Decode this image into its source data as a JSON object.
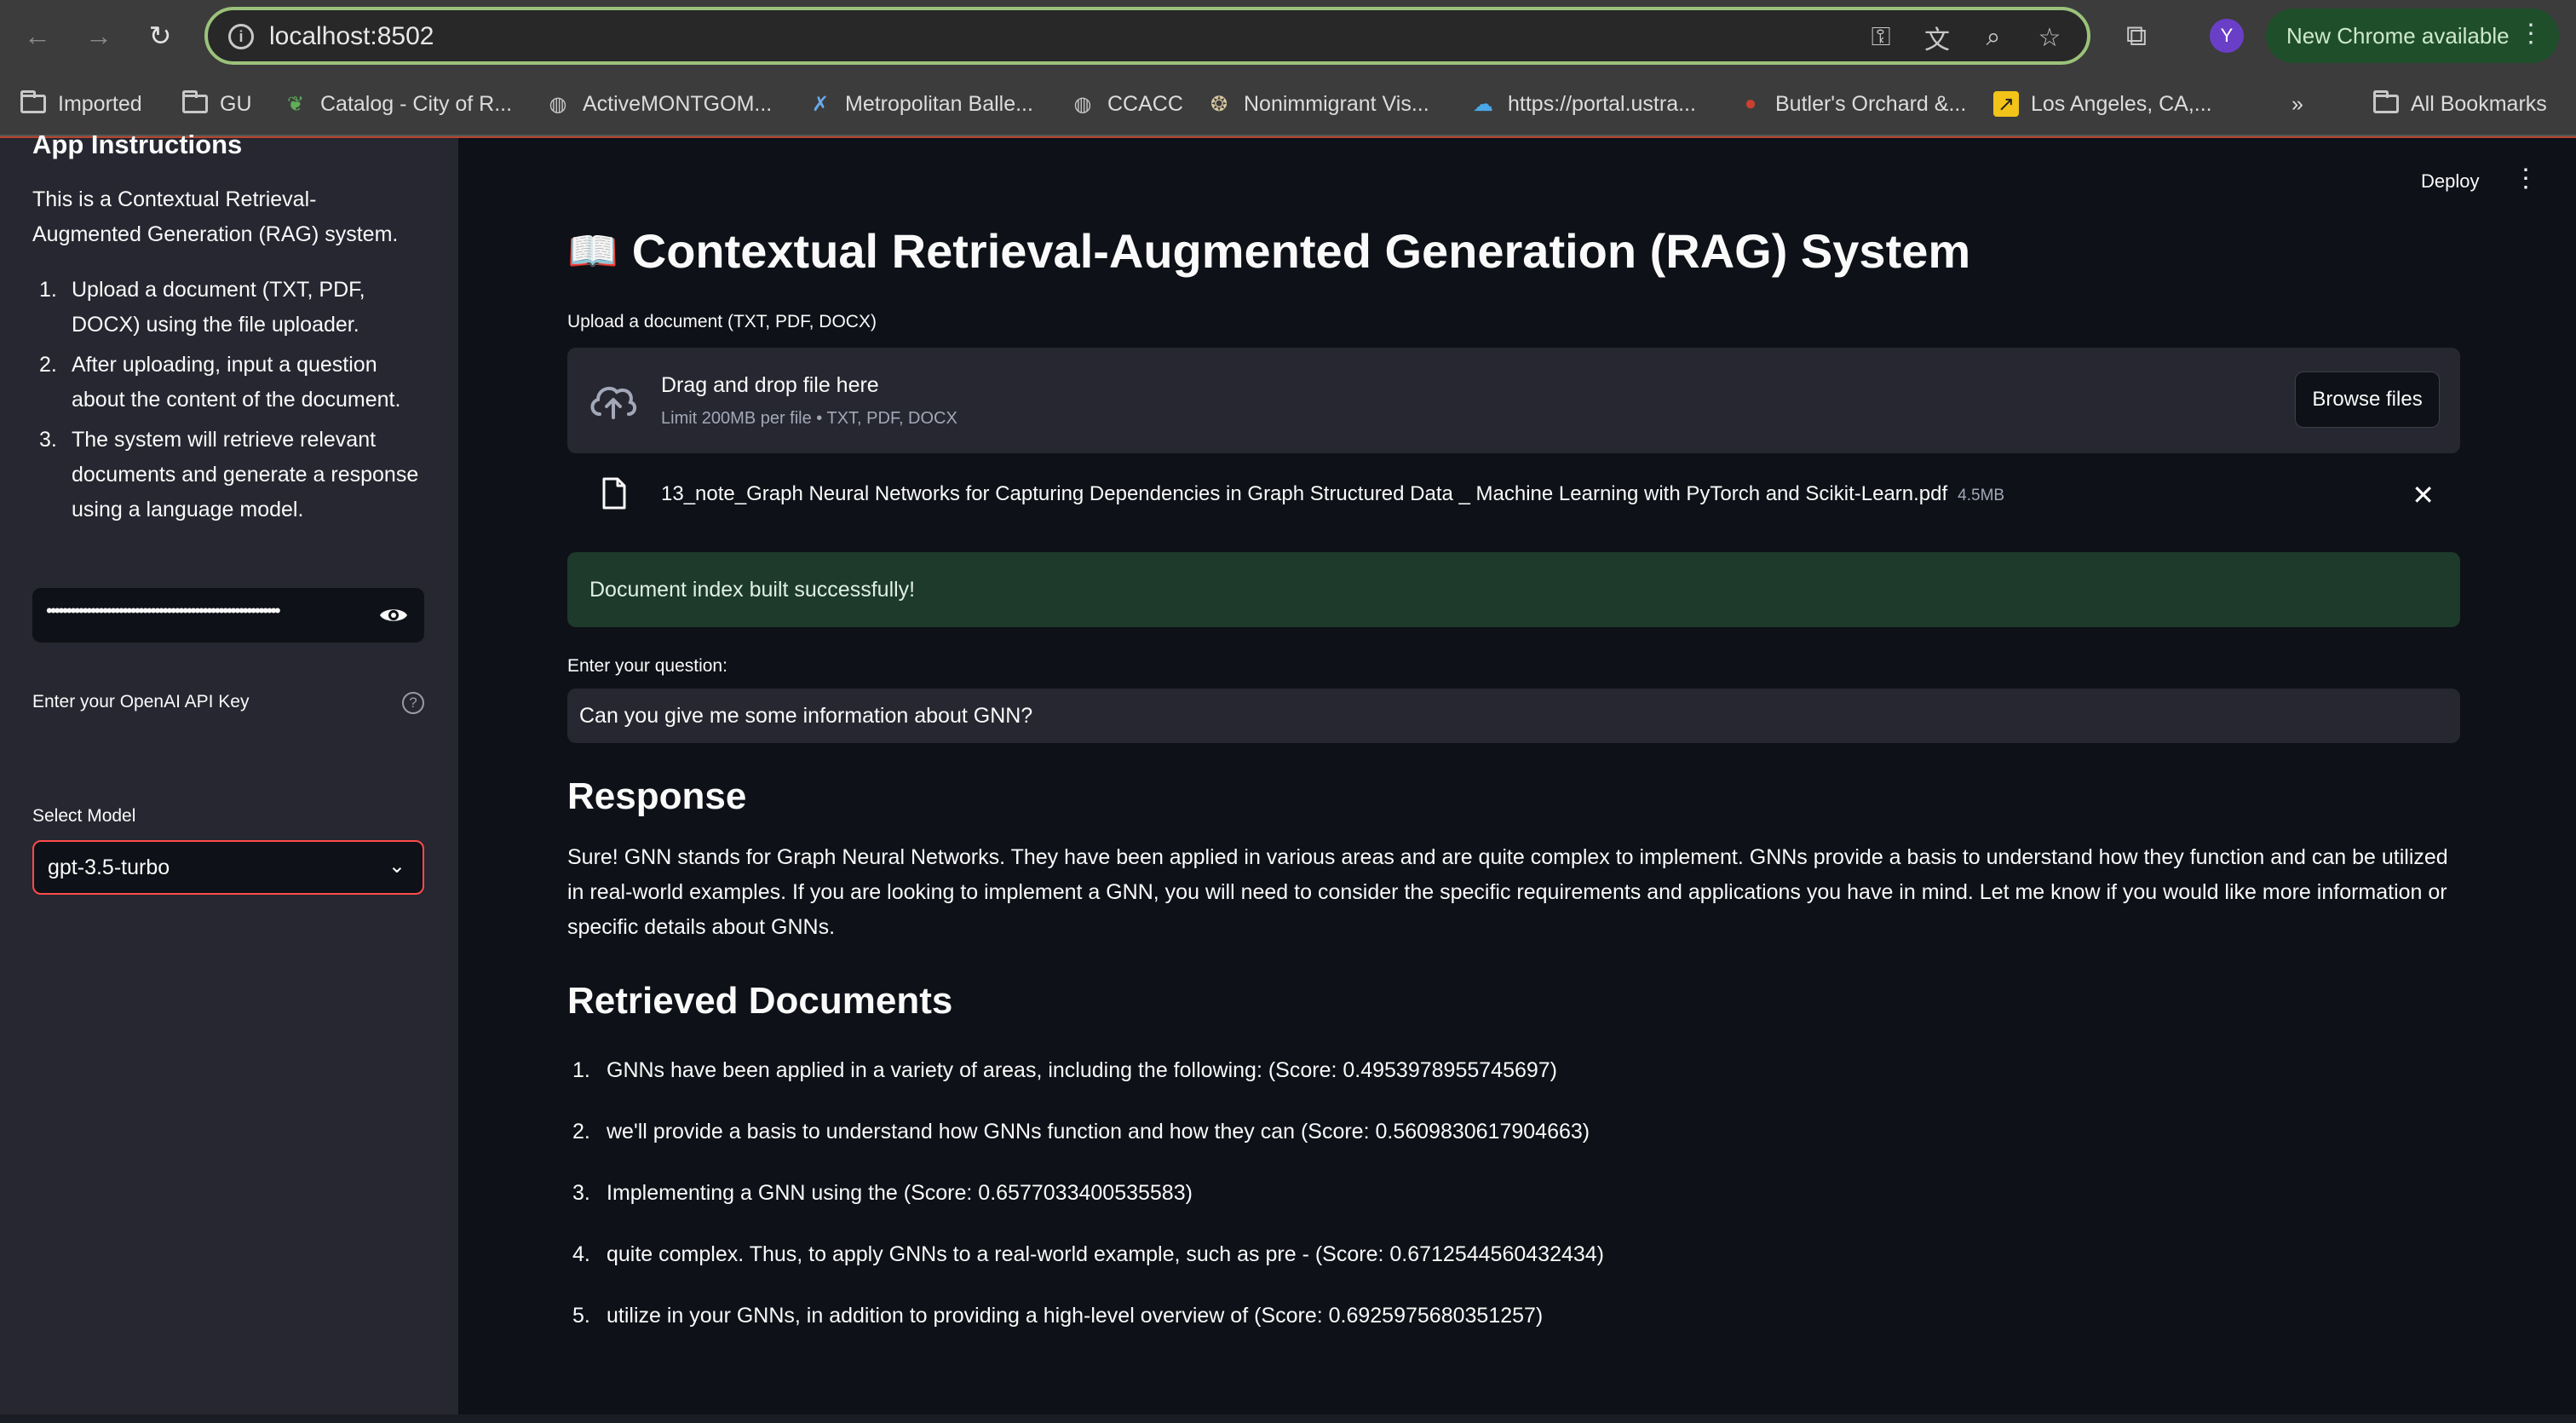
{
  "browser": {
    "url": "localhost:8502",
    "profile_initial": "Y",
    "update_label": "New Chrome available",
    "bookmarks": [
      "Imported",
      "GU",
      "Catalog - City of R...",
      "ActiveMONTGOM...",
      "Metropolitan Balle...",
      "CCACC",
      "Nonimmigrant Vis...",
      "https://portal.ustra...",
      "Butler's Orchard &...",
      "Los Angeles, CA,...",
      "All Bookmarks"
    ],
    "overflow_label": "»"
  },
  "sidebar": {
    "title": "App Instructions",
    "description": "This is a Contextual Retrieval-Augmented Generation (RAG) system.",
    "steps": [
      "Upload a document (TXT, PDF, DOCX) using the file uploader.",
      "After uploading, input a question about the content of the document.",
      "The system will retrieve relevant documents and generate a response using a language model."
    ],
    "api_key_label": "Enter your OpenAI API Key",
    "api_key_value": "••••••••••••••••••••••••••••••••••••••••••••••••••••••••••",
    "model_label": "Select Model",
    "model_value": "gpt-3.5-turbo"
  },
  "header": {
    "deploy_label": "Deploy"
  },
  "main": {
    "title_icon": "📖",
    "title": "Contextual Retrieval-Augmented Generation (RAG) System",
    "upload_label": "Upload a document (TXT, PDF, DOCX)",
    "dropzone_main": "Drag and drop file here",
    "dropzone_sub": "Limit 200MB per file • TXT, PDF, DOCX",
    "browse_label": "Browse files",
    "file_name": "13_note_Graph Neural Networks for Capturing Dependencies in Graph Structured Data _ Machine Learning with PyTorch and Scikit-Learn.pdf",
    "file_size": "4.5MB",
    "success_message": "Document index built successfully!",
    "question_label": "Enter your question:",
    "question_value": "Can you give me some information about GNN?",
    "response_heading": "Response",
    "response_text": "Sure! GNN stands for Graph Neural Networks. They have been applied in various areas and are quite complex to implement. GNNs provide a basis to understand how they function and can be utilized in real-world examples. If you are looking to implement a GNN, you will need to consider the specific requirements and applications you have in mind. Let me know if you would like more information or specific details about GNNs.",
    "retrieved_heading": "Retrieved Documents",
    "retrieved_docs": [
      "GNNs have been applied in a variety of areas, including the following: (Score: 0.4953978955745697)",
      "we'll provide a basis to understand how GNNs function and how they can (Score: 0.5609830617904663)",
      "Implementing a GNN using the (Score: 0.6577033400535583)",
      "quite complex. Thus, to apply GNNs to a real-world example, such as pre - (Score: 0.6712544560432434)",
      "utilize in your GNNs, in addition to providing a high-level overview of (Score: 0.6925975680351257)"
    ]
  }
}
